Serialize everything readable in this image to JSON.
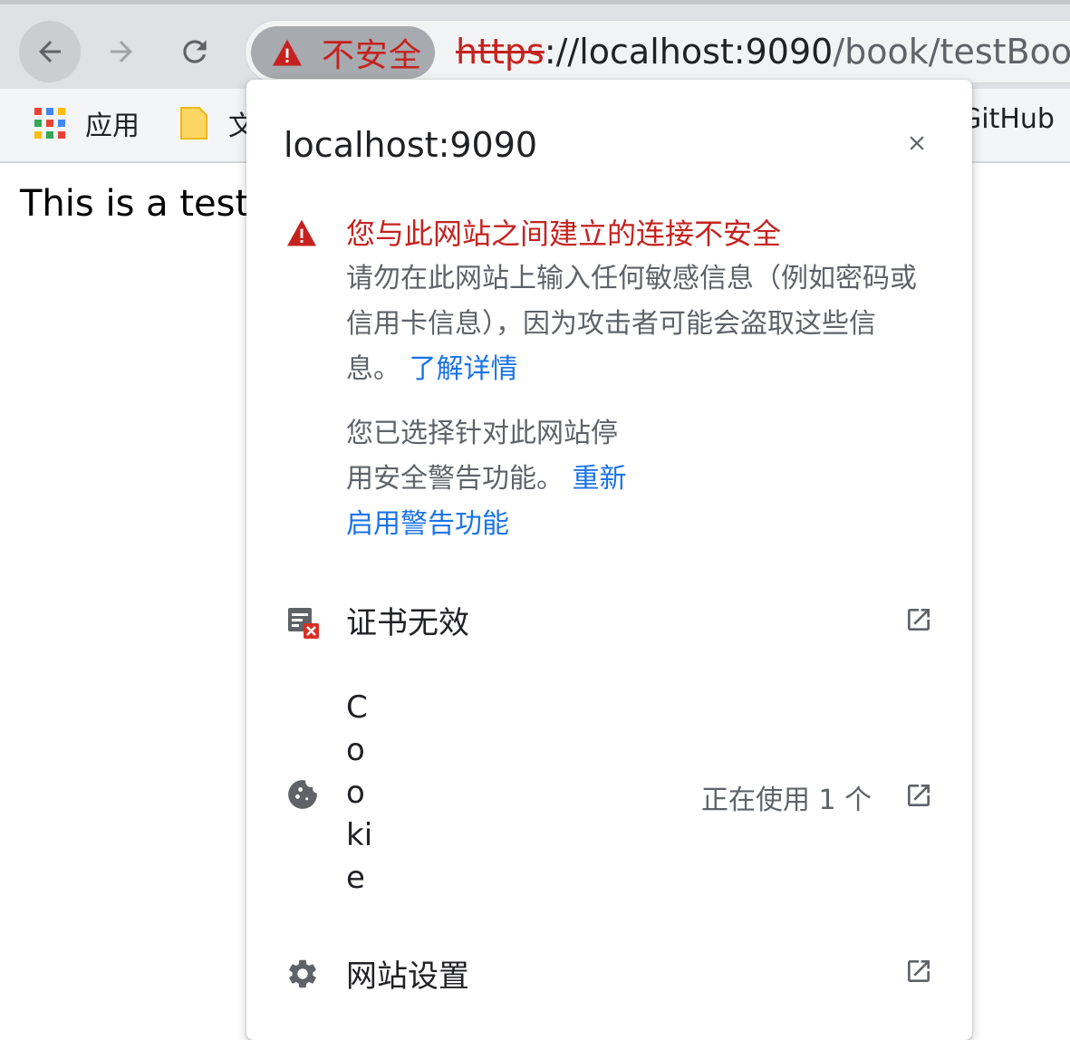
{
  "toolbar": {
    "security_label": "不安全",
    "url_scheme": "https",
    "url_host": "://localhost:9090",
    "url_path": "/book/testBook"
  },
  "bookmarks": {
    "apps_label": "应用",
    "folder_label": "文",
    "github_label": "GitHub"
  },
  "page": {
    "text": "This is a test b"
  },
  "popup": {
    "title": "localhost:9090",
    "warning_heading": "您与此网站之间建立的连接不安全",
    "warning_body": "请勿在此网站上输入任何敏感信息（例如密码或信用卡信息），因为攻击者可能会盗取这些信息。",
    "learn_more": "了解详情",
    "disabled_note": "您已选择针对此网站停用安全警告功能。",
    "reenable_link": "重新启用警告功能",
    "cert_label": "证书无效",
    "cookie_label": "Cookie",
    "cookie_status": "正在使用 1 个",
    "site_settings_label": "网站设置"
  },
  "colors": {
    "danger": "#c5221f",
    "link": "#1a73e8",
    "muted": "#5f6368"
  }
}
